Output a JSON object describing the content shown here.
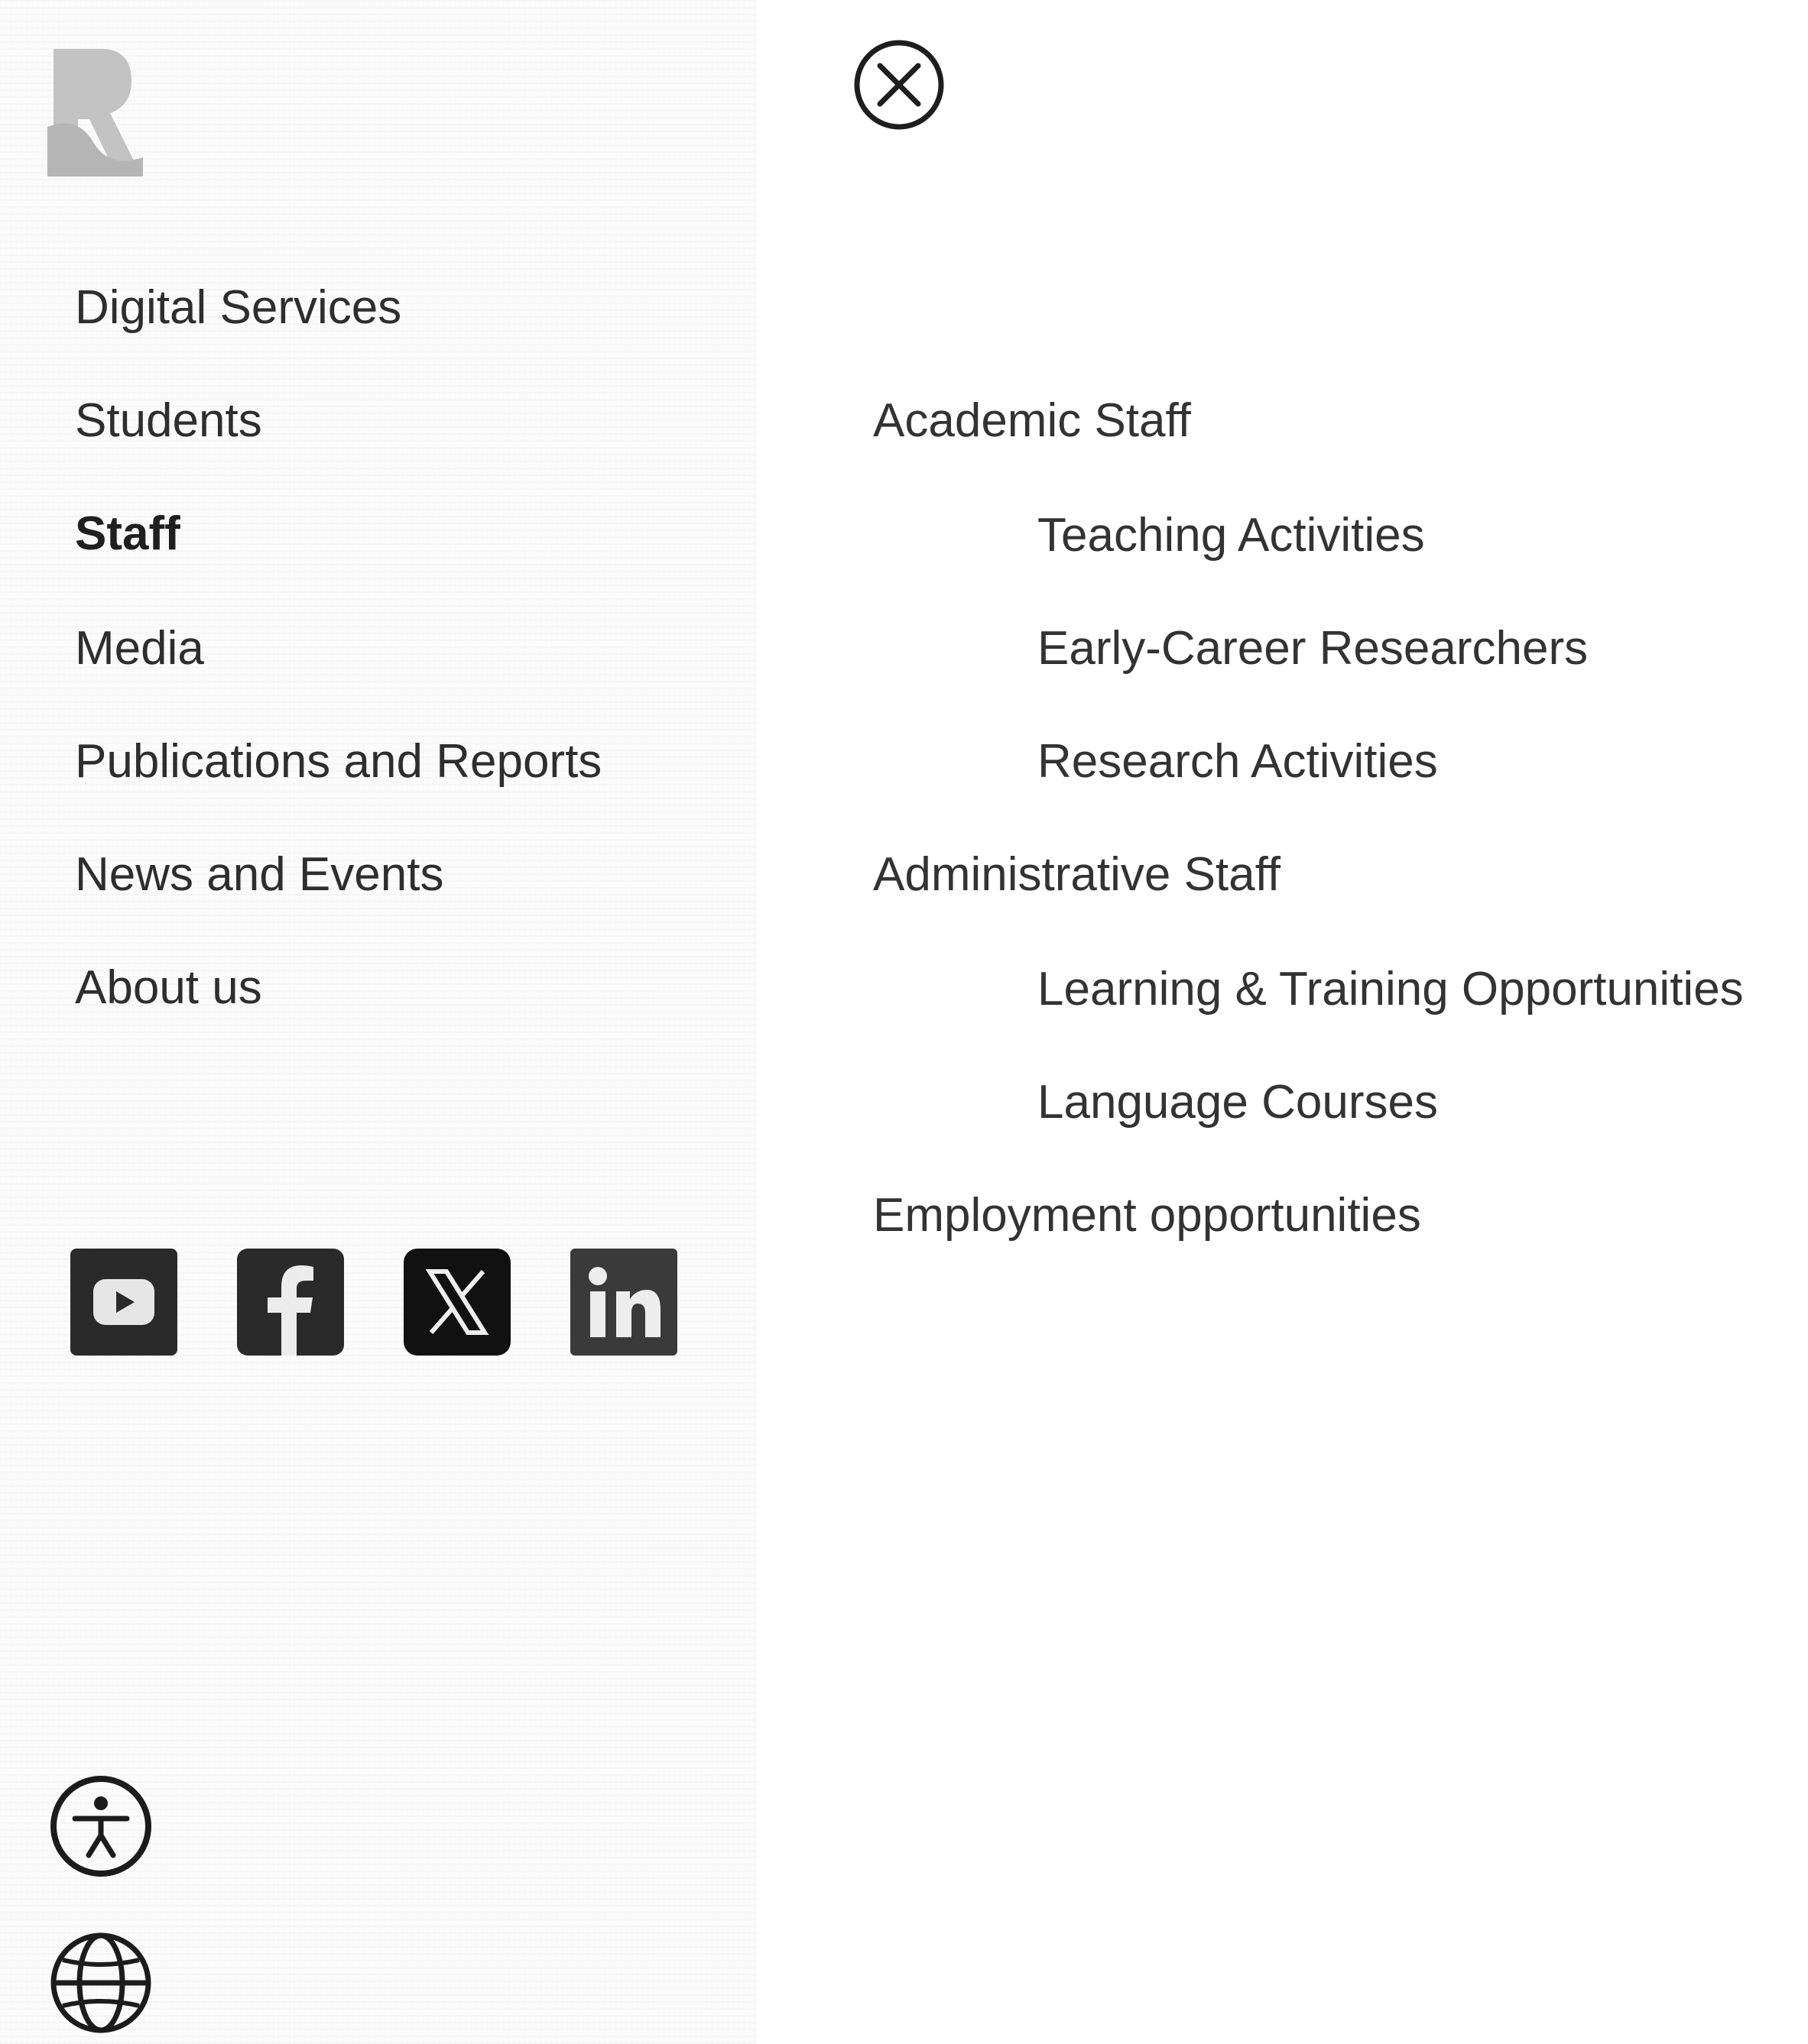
{
  "brand": {
    "logo_icon": "r-logo-icon"
  },
  "header": {
    "close_icon": "close-circle-icon"
  },
  "nav": {
    "items": [
      {
        "label": "Digital Services",
        "active": false
      },
      {
        "label": "Students",
        "active": false
      },
      {
        "label": "Staff",
        "active": true
      },
      {
        "label": "Media",
        "active": false
      },
      {
        "label": "Publications and Reports",
        "active": false
      },
      {
        "label": "News and Events",
        "active": false
      },
      {
        "label": "About us",
        "active": false
      }
    ]
  },
  "submenu": {
    "items": [
      {
        "label": "Academic Staff",
        "level": 1
      },
      {
        "label": "Teaching Activities",
        "level": 2
      },
      {
        "label": "Early-Career Researchers",
        "level": 2
      },
      {
        "label": "Research Activities",
        "level": 2
      },
      {
        "label": "Administrative Staff",
        "level": 1
      },
      {
        "label": "Learning & Training Opportunities",
        "level": 2
      },
      {
        "label": "Language Courses",
        "level": 2
      },
      {
        "label": "Employment opportunities",
        "level": 1
      }
    ]
  },
  "social": {
    "icons": [
      "youtube-icon",
      "facebook-icon",
      "x-icon",
      "linkedin-icon"
    ]
  },
  "utilities": {
    "icons": [
      "accessibility-icon",
      "globe-icon"
    ]
  },
  "colors": {
    "text": "#303030",
    "icon_dark": "#2a2a2a",
    "logo_gray": "#bdbdbd",
    "background": "#ffffff"
  }
}
